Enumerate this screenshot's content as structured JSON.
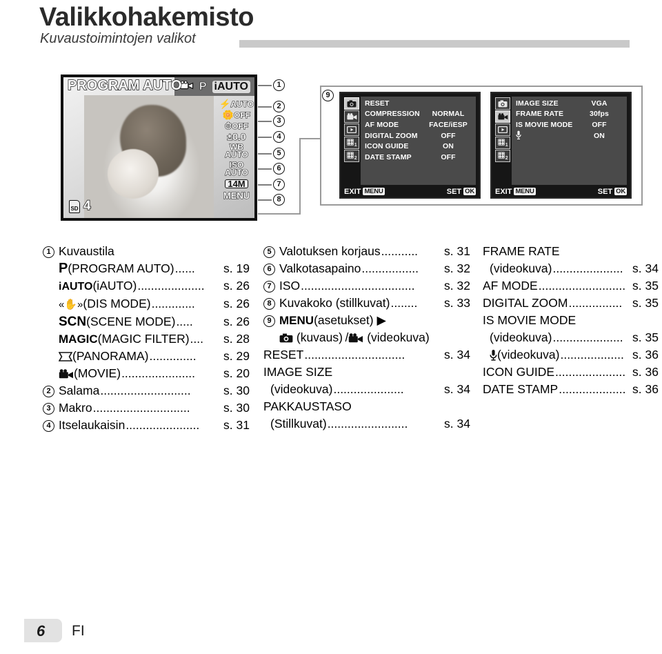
{
  "header": {
    "title": "Valikkohakemisto",
    "subtitle": "Kuvaustoimintojen valikot"
  },
  "camera_lcd": {
    "title": "PROGRAM AUTO",
    "mode_icons": [
      "movie-icon",
      "P",
      "iAUTO"
    ],
    "selected_mode": "iAUTO",
    "right_indicators": [
      "AUTO",
      "OFF",
      "OFF",
      "±0.0",
      "WB AUTO",
      "ISO AUTO",
      "14M",
      "MENU"
    ],
    "indicator_flash": "AUTO",
    "indicator_macro": "OFF",
    "indicator_selftimer": "OFF",
    "indicator_exposure": "±0.0",
    "indicator_wb_line1": "WB",
    "indicator_wb_line2": "AUTO",
    "indicator_iso_line1": "ISO",
    "indicator_iso_line2": "AUTO",
    "indicator_size": "14M",
    "indicator_size_suffix": "M",
    "indicator_menu": "MENU",
    "sd_label": "SD",
    "sd_count": "4"
  },
  "callouts": [
    "1",
    "2",
    "3",
    "4",
    "5",
    "6",
    "7",
    "8",
    "9"
  ],
  "menu_screen_still": {
    "tabs": [
      "camera-icon",
      "movie-icon",
      "playback-icon",
      "settings1-icon",
      "settings2-icon"
    ],
    "active_tab_index": 0,
    "rows": [
      {
        "label": "RESET",
        "value": ""
      },
      {
        "label": "COMPRESSION",
        "value": "NORMAL"
      },
      {
        "label": "AF MODE",
        "value": "FACE/iESP"
      },
      {
        "label": "DIGITAL ZOOM",
        "value": "OFF"
      },
      {
        "label": "ICON GUIDE",
        "value": "ON"
      },
      {
        "label": "DATE STAMP",
        "value": "OFF"
      }
    ],
    "exit_label": "EXIT",
    "exit_key": "MENU",
    "set_label": "SET",
    "set_key": "OK"
  },
  "menu_screen_movie": {
    "tabs": [
      "camera-icon",
      "movie-icon",
      "playback-icon",
      "settings1-icon",
      "settings2-icon"
    ],
    "active_tab_index": 1,
    "rows": [
      {
        "label": "IMAGE SIZE",
        "value": "VGA"
      },
      {
        "label": "FRAME RATE",
        "value": "30fps"
      },
      {
        "label": "IS MOVIE MODE",
        "value": "OFF"
      },
      {
        "label": "mic-icon",
        "value": "ON"
      }
    ],
    "exit_label": "EXIT",
    "exit_key": "MENU",
    "set_label": "SET",
    "set_key": "OK"
  },
  "index_col1": [
    {
      "num": "1",
      "text": "Kuvaustila",
      "dots": "",
      "page": ""
    },
    {
      "indent": true,
      "sym": "P",
      "text": " (PROGRAM AUTO)",
      "dots": "......",
      "page": "s. 19"
    },
    {
      "indent": true,
      "sym": "iAUTO",
      "text": " (iAUTO)",
      "dots": "....................",
      "page": "s. 26"
    },
    {
      "indent": true,
      "sym": "«✋»",
      "text": " (DIS MODE)",
      "dots": ".............",
      "page": "s. 26"
    },
    {
      "indent": true,
      "sym": "SCN",
      "text": " (SCENE MODE)",
      "dots": ".....",
      "page": "s. 26"
    },
    {
      "indent": true,
      "sym": "MAGIC",
      "text": " (MAGIC FILTER)",
      "dots": "....",
      "page": "s. 28"
    },
    {
      "indent": true,
      "sym": "⋈",
      "text": " (PANORAMA)",
      "dots": "..............",
      "page": "s. 29"
    },
    {
      "indent": true,
      "sym": "movie-icon",
      "text": " (MOVIE)",
      "dots": "......................",
      "page": "s. 20"
    },
    {
      "num": "2",
      "text": "Salama",
      "dots": "...........................",
      "page": "s. 30"
    },
    {
      "num": "3",
      "text": "Makro",
      "dots": ".............................",
      "page": "s. 30"
    },
    {
      "num": "4",
      "text": "Itselaukaisin",
      "dots": "......................",
      "page": "s. 31"
    }
  ],
  "index_col2": [
    {
      "num": "5",
      "text": "Valotuksen korjaus",
      "dots": "...........",
      "page": "s. 31"
    },
    {
      "num": "6",
      "text": "Valkotasapaino",
      "dots": ".................",
      "page": "s. 32"
    },
    {
      "num": "7",
      "text": "ISO",
      "dots": "..................................",
      "page": "s. 32"
    },
    {
      "num": "8",
      "text": "Kuvakoko (stillkuvat)",
      "dots": "........",
      "page": "s. 33"
    },
    {
      "num": "9",
      "sym": "MENU",
      "text": " (asetukset) ▶",
      "dots": "",
      "page": ""
    },
    {
      "indent": true,
      "sym": "camera-icon",
      "text": " (kuvaus) / movie-icon (videokuva)",
      "dots": "",
      "page": ""
    },
    {
      "indent": false,
      "nonum": true,
      "text": "RESET",
      "dots": "..............................",
      "page": "s. 34"
    },
    {
      "indent": false,
      "nonum": true,
      "text": "IMAGE SIZE",
      "dots": "",
      "page": ""
    },
    {
      "indent": true,
      "nonum": true,
      "text": "(videokuva)",
      "dots": ".....................",
      "page": "s. 34"
    },
    {
      "indent": false,
      "nonum": true,
      "text": "PAKKAUSTASO",
      "dots": "",
      "page": ""
    },
    {
      "indent": true,
      "nonum": true,
      "text": "(Stillkuvat)",
      "dots": "........................",
      "page": "s. 34"
    }
  ],
  "index_col3": [
    {
      "text": "FRAME RATE",
      "dots": "",
      "page": ""
    },
    {
      "indent": true,
      "text": "(videokuva)",
      "dots": ".....................",
      "page": "s. 34"
    },
    {
      "text": "AF MODE",
      "dots": "..........................",
      "page": "s. 35"
    },
    {
      "text": "DIGITAL ZOOM",
      "dots": "................",
      "page": "s. 35"
    },
    {
      "text": "IS MOVIE MODE",
      "dots": "",
      "page": ""
    },
    {
      "indent": true,
      "text": "(videokuva)",
      "dots": ".....................",
      "page": "s. 35"
    },
    {
      "indent": true,
      "sym": "mic-icon",
      "text": " (videokuva)",
      "dots": "...................",
      "page": "s. 36"
    },
    {
      "text": "ICON GUIDE",
      "dots": ".....................",
      "page": "s. 36"
    },
    {
      "text": "DATE STAMP",
      "dots": "....................",
      "page": "s. 36"
    }
  ],
  "footer": {
    "page_number": "6",
    "language": "FI"
  },
  "colors": {
    "rule": "#c9c9c9",
    "lcd_border": "#111111",
    "menu_bg": "#161616",
    "menu_list_bg": "#4a4a4a",
    "footer_tab": "#e2e2e2"
  }
}
